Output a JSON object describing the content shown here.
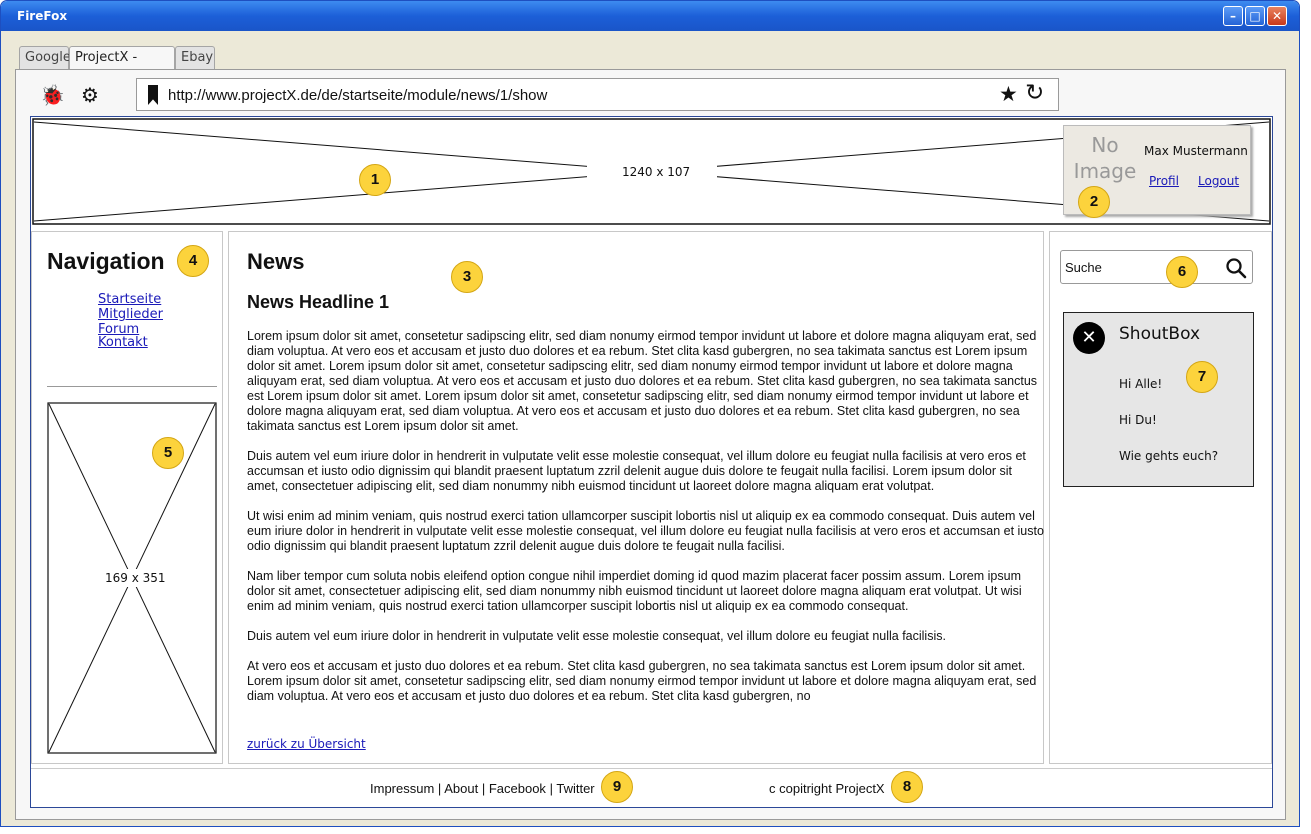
{
  "window": {
    "title": "FireFox"
  },
  "tabs": [
    {
      "label": "Google"
    },
    {
      "label": "ProjectX - News"
    },
    {
      "label": "Ebay"
    }
  ],
  "toolbar": {
    "url": "http://www.projectX.de/de/startseite/module/news/1/show"
  },
  "header": {
    "banner_label": "1240 x 107",
    "no_image_line1": "No",
    "no_image_line2": "Image",
    "user_name": "Max Mustermann",
    "profile_link": "Profil",
    "logout_link": "Logout"
  },
  "navigation": {
    "heading": "Navigation",
    "items": [
      {
        "label": "Startseite"
      },
      {
        "label": "Mitglieder"
      },
      {
        "label": "Forum"
      },
      {
        "label": "Kontakt"
      }
    ],
    "image_label": "169 x 351"
  },
  "news": {
    "heading": "News",
    "headline": "News Headline 1",
    "paragraphs": [
      "Lorem ipsum dolor sit amet, consetetur sadipscing elitr, sed diam nonumy eirmod tempor invidunt ut labore et dolore magna aliquyam erat, sed diam voluptua. At vero eos et accusam et justo duo dolores et ea rebum. Stet clita kasd gubergren, no sea takimata sanctus est Lorem ipsum dolor sit amet. Lorem ipsum dolor sit amet, consetetur sadipscing elitr, sed diam nonumy eirmod tempor invidunt ut labore et dolore magna aliquyam erat, sed diam voluptua. At vero eos et accusam et justo duo dolores et ea rebum. Stet clita kasd gubergren, no sea takimata sanctus est Lorem ipsum dolor sit amet. Lorem ipsum dolor sit amet, consetetur sadipscing elitr, sed diam nonumy eirmod tempor invidunt ut labore et dolore magna aliquyam erat, sed diam voluptua. At vero eos et accusam et justo duo dolores et ea rebum. Stet clita kasd gubergren, no sea takimata sanctus est Lorem ipsum dolor sit amet.",
      "Duis autem vel eum iriure dolor in hendrerit in vulputate velit esse molestie consequat, vel illum dolore eu feugiat nulla facilisis at vero eros et accumsan et iusto odio dignissim qui blandit praesent luptatum zzril delenit augue duis dolore te feugait nulla facilisi. Lorem ipsum dolor sit amet, consectetuer adipiscing elit, sed diam nonummy nibh euismod tincidunt ut laoreet dolore magna aliquam erat volutpat.",
      "Ut wisi enim ad minim veniam, quis nostrud exerci tation ullamcorper suscipit lobortis nisl ut aliquip ex ea commodo consequat. Duis autem vel eum iriure dolor in hendrerit in vulputate velit esse molestie consequat, vel illum dolore eu feugiat nulla facilisis at vero eros et accumsan et iusto odio dignissim qui blandit praesent luptatum zzril delenit augue duis dolore te feugait nulla facilisi.",
      "Nam liber tempor cum soluta nobis eleifend option congue nihil imperdiet doming id quod mazim placerat facer possim assum. Lorem ipsum dolor sit amet, consectetuer adipiscing elit, sed diam nonummy nibh euismod tincidunt ut laoreet dolore magna aliquam erat volutpat. Ut wisi enim ad minim veniam, quis nostrud exerci tation ullamcorper suscipit lobortis nisl ut aliquip ex ea commodo consequat.",
      "Duis autem vel eum iriure dolor in hendrerit in vulputate velit esse molestie consequat, vel illum dolore eu feugiat nulla facilisis.",
      "At vero eos et accusam et justo duo dolores et ea rebum. Stet clita kasd gubergren, no sea takimata sanctus est Lorem ipsum dolor sit amet. Lorem ipsum dolor sit amet, consetetur sadipscing elitr, sed diam nonumy eirmod tempor invidunt ut labore et dolore magna aliquyam erat, sed diam voluptua. At vero eos et accusam et justo duo dolores et ea rebum. Stet clita kasd gubergren, no"
    ],
    "back_link": "zurück zu Übersicht"
  },
  "sidebar": {
    "search_placeholder": "Suche",
    "shoutbox_title": "ShoutBox",
    "messages": [
      {
        "text": "Hi Alle!"
      },
      {
        "text": "Hi Du!"
      },
      {
        "text": "Wie gehts euch?"
      }
    ]
  },
  "footer": {
    "links": [
      {
        "label": "Impressum"
      },
      {
        "label": "About"
      },
      {
        "label": "Facebook"
      },
      {
        "label": "Twitter"
      }
    ],
    "separator": "|",
    "copyright": "c copitright ProjectX"
  },
  "annotations": [
    "1",
    "2",
    "3",
    "4",
    "5",
    "6",
    "7",
    "8",
    "9"
  ],
  "colors": {
    "annotation": "#fcd33c",
    "link": "#1a1ab8",
    "titlebar": "#1c5fd8"
  }
}
